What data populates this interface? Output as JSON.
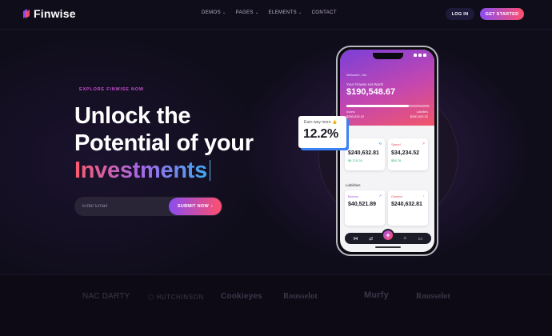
{
  "brand": {
    "name": "Finwise"
  },
  "nav": {
    "menu": [
      {
        "label": "DEMOS",
        "has_caret": true
      },
      {
        "label": "PAGES",
        "has_caret": true
      },
      {
        "label": "ELEMENTS",
        "has_caret": true
      },
      {
        "label": "CONTACT",
        "has_caret": false
      }
    ],
    "login_label": "LOG IN",
    "cta_label": "GET STARTED"
  },
  "hero": {
    "kicker": "EXPLORE FINWISE NOW",
    "line1": "Unlock the",
    "line2": "Potential of your",
    "line3": "Investments",
    "email_placeholder": "Enter Email",
    "submit_label": "SUBMIT NOW",
    "submit_arrow": "›"
  },
  "phone": {
    "welcome": "Welcome, Jim",
    "net_worth_label": "Your Finwise net Worth",
    "net_worth_value": "$190,548.67",
    "assets_ratio": 0.75,
    "assets_label": "Assets",
    "assets_value": "$250,632.22",
    "liabilities_label": "Liabilities",
    "liabilities_value": "$250,632.22",
    "cards_top": [
      {
        "title": "",
        "value": "$240,632.81",
        "sub": "$6,715.34",
        "title_color": "#2b8ad8"
      },
      {
        "title": "Spend",
        "value": "$34,234.52",
        "sub": "$56.76",
        "title_color": "#e8485a"
      }
    ],
    "section_label": "Liabilities",
    "cards_bottom": [
      {
        "title": "Borrow",
        "value": "$40,521.89",
        "title_color": "#a24fe0"
      },
      {
        "title": "Owners",
        "value": "$240,632.81",
        "title_color": "#e8485a"
      }
    ],
    "fab_label": "+"
  },
  "float_card": {
    "label": "Earn way more",
    "emoji": "👍",
    "value": "12.2%"
  },
  "partners": [
    "NAC DARTY",
    "HUTCHINSON",
    "Cookieyes",
    "Rousselot",
    "Murfy",
    "Rousselot"
  ],
  "colors": {
    "accent_purple": "#8a4df0",
    "accent_pink": "#ff4f6d",
    "background": "#100d1b"
  }
}
